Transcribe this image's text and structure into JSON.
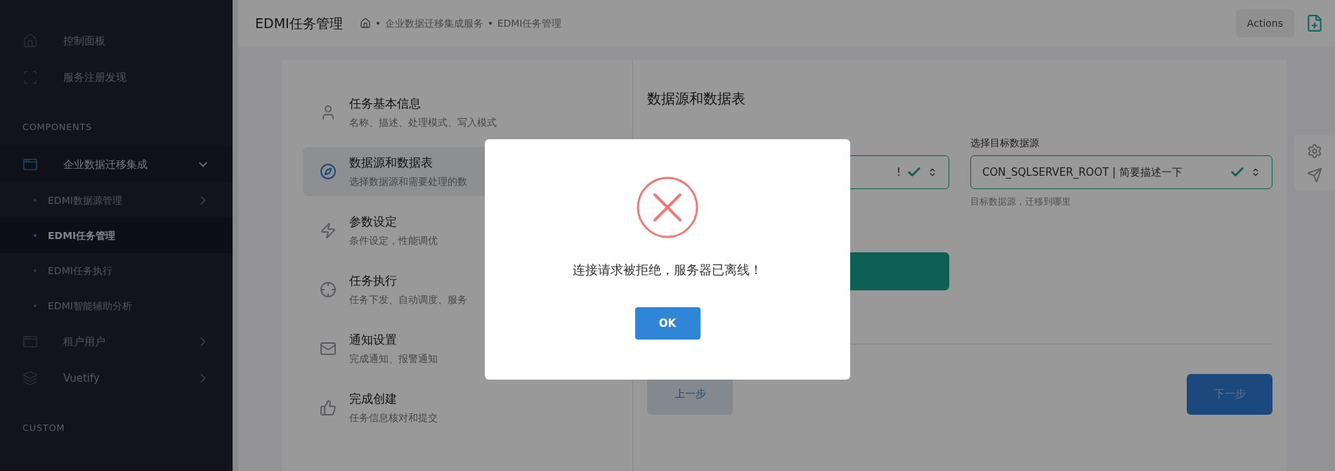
{
  "sidebar": {
    "items": [
      {
        "kind": "link",
        "label": "控制面板"
      },
      {
        "kind": "link",
        "label": "服务注册发现"
      },
      {
        "kind": "heading",
        "label": "COMPONENTS"
      },
      {
        "kind": "group",
        "label": "企业数据迁移集成",
        "expanded": true,
        "children": [
          {
            "label": "EDMI数据源管理",
            "selected": false,
            "has_children": true
          },
          {
            "label": "EDMI任务管理",
            "selected": true,
            "has_children": false
          },
          {
            "label": "EDMI任务执行",
            "selected": false,
            "has_children": false
          },
          {
            "label": "EDMI智能辅助分析",
            "selected": false,
            "has_children": false
          }
        ]
      },
      {
        "kind": "group",
        "label": "租户用户",
        "expanded": false
      },
      {
        "kind": "group",
        "label": "Vuetify",
        "expanded": false
      },
      {
        "kind": "heading",
        "label": "CUSTOM"
      }
    ]
  },
  "header": {
    "title": "EDMI任务管理",
    "breadcrumbs": [
      "企业数据迁移集成服务",
      "EDMI任务管理"
    ],
    "actions": "Actions"
  },
  "steps": [
    {
      "title": "任务基本信息",
      "description": "名称、描述、处理模式、写入模式",
      "selected": false
    },
    {
      "title": "数据源和数据表",
      "description": "选择数据源和需要处理的数",
      "selected": true
    },
    {
      "title": "参数设定",
      "description": "条件设定，性能调优",
      "selected": false
    },
    {
      "title": "任务执行",
      "description": "任务下发、自动调度、服务",
      "selected": false
    },
    {
      "title": "通知设置",
      "description": "完成通知、报警通知",
      "selected": false
    },
    {
      "title": "完成创建",
      "description": "任务信息核对和提交",
      "selected": false
    }
  ],
  "form": {
    "title": "数据源和数据表",
    "fields": [
      {
        "value": "!",
        "valid": true
      },
      {
        "label": "选择目标数据源",
        "value": "CON_SQLSERVER_ROOT | 简要描述一下",
        "valid": true,
        "helper": "目标数据源，迁移到哪里"
      }
    ],
    "prev": "上一步",
    "next": "下一步"
  },
  "dialog": {
    "message": "连接请求被拒绝，服务器已离线！",
    "button": "OK"
  }
}
